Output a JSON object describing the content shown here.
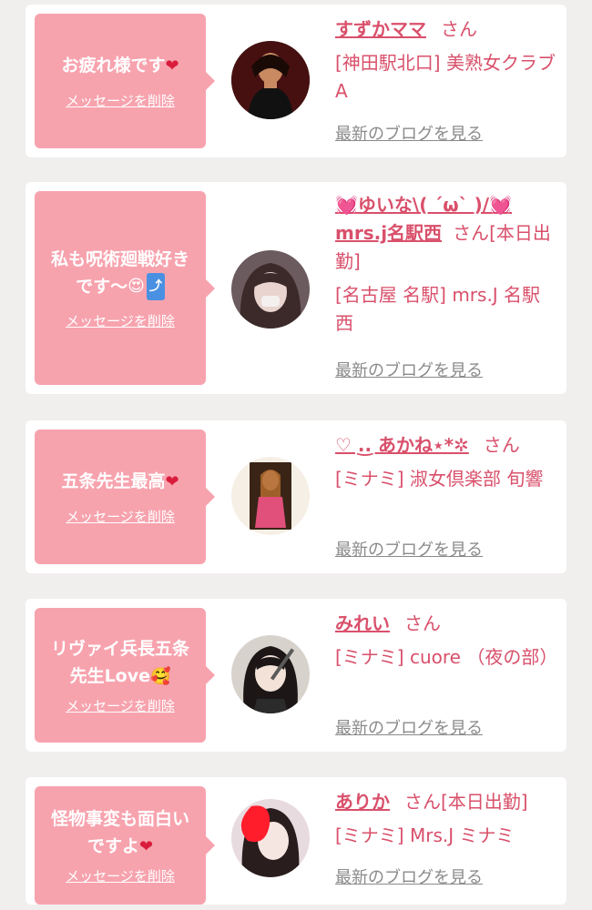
{
  "colors": {
    "bubble_bg": "#f7a3ae",
    "accent_pink": "#d9506b",
    "page_bg": "#f1eeee",
    "link_gray": "#8a8a8a"
  },
  "cards": [
    {
      "message_lines": [
        "お疲れ様です"
      ],
      "message_emoji": "heart",
      "delete_label": "メッセージを削除",
      "name": "すずかママ",
      "honorific": "さん",
      "status": "",
      "shop": "[神田駅北口] 美熟女クラブA",
      "blog_link": "最新のブログを見る"
    },
    {
      "message_lines": [
        "私も呪術廻戦好き",
        "です〜"
      ],
      "message_emoji": "heart-eyes, arrow-up-right",
      "delete_label": "メッセージを削除",
      "name": "ゆいな\\( ´ω` )/ mrs.j名駅西",
      "name_line1": "💓ゆいな\\( ´ω` )/💓",
      "name_line2": "mrs.j名駅西",
      "honorific": "さん",
      "status": "[本日出勤]",
      "shop": "[名古屋 名駅] mrs.J 名駅西",
      "blog_link": "最新のブログを見る"
    },
    {
      "message_lines": [
        "五条先生最高"
      ],
      "message_emoji": "heart",
      "delete_label": "メッセージを削除",
      "name": "♡ .͜. あかね⋆*✲",
      "honorific": "さん",
      "status": "",
      "shop": "[ミナミ] 淑女倶楽部 旬響",
      "blog_link": "最新のブログを見る"
    },
    {
      "message_lines": [
        "リヴァイ兵長五条",
        "先生Love"
      ],
      "message_emoji": "smiling-face-with-hearts",
      "delete_label": "メッセージを削除",
      "name": "みれい",
      "honorific": "さん",
      "status": "",
      "shop": "[ミナミ] cuore （夜の部）",
      "blog_link": "最新のブログを見る"
    },
    {
      "message_lines": [
        "怪物事変も面白い",
        "ですよ"
      ],
      "message_emoji": "heart",
      "delete_label": "メッセージを削除",
      "name": "ありか",
      "honorific": "さん",
      "status": "[本日出勤]",
      "shop": "[ミナミ] Mrs.J ミナミ",
      "blog_link": "最新のブログを見る"
    }
  ]
}
